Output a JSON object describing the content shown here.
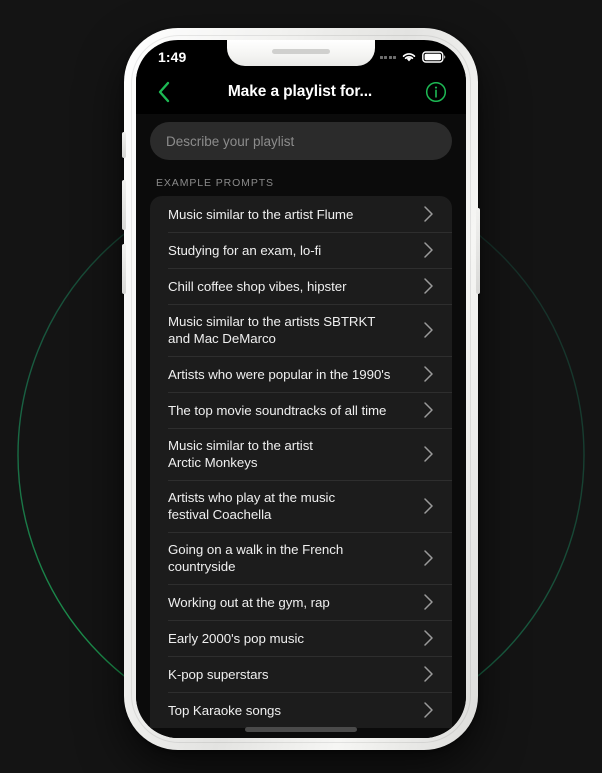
{
  "status_bar": {
    "time": "1:49",
    "cellular_icon": "cellular-dots-icon",
    "wifi_icon": "wifi-icon",
    "battery_icon": "battery-icon"
  },
  "nav": {
    "back_icon": "chevron-left-icon",
    "title": "Make a playlist for...",
    "info_icon": "info-circle-icon"
  },
  "search": {
    "placeholder": "Describe your playlist",
    "value": ""
  },
  "section": {
    "label": "EXAMPLE PROMPTS"
  },
  "prompts": [
    {
      "text": "Music similar to the artist Flume",
      "lines": 1
    },
    {
      "text": "Studying for an exam, lo-fi",
      "lines": 1
    },
    {
      "text": "Chill coffee shop vibes, hipster",
      "lines": 1
    },
    {
      "text": "Music similar to the artists SBTRKT\nand Mac DeMarco",
      "lines": 2
    },
    {
      "text": "Artists who were popular in the 1990's",
      "lines": 1
    },
    {
      "text": "The top movie soundtracks of all time",
      "lines": 1
    },
    {
      "text": "Music similar to the artist\nArctic Monkeys",
      "lines": 2
    },
    {
      "text": "Artists who play at the music\nfestival Coachella",
      "lines": 2
    },
    {
      "text": "Going on a walk in the French\ncountryside",
      "lines": 2
    },
    {
      "text": "Working out at the gym, rap",
      "lines": 1
    },
    {
      "text": "Early 2000's pop music",
      "lines": 1
    },
    {
      "text": "K-pop superstars",
      "lines": 1
    },
    {
      "text": "Top Karaoke songs",
      "lines": 1
    }
  ],
  "chevron_icon": "chevron-right-icon",
  "home_indicator": "home-indicator-bar",
  "colors": {
    "accent_green": "#1db954",
    "page_background": "#141414",
    "screen_background": "#0b0b0b",
    "card_background": "#1c1c1c",
    "divider": "#2e2e2e",
    "input_background": "#2b2b2b",
    "secondary_text": "#8a8a8a",
    "primary_text": "#efefef",
    "arc_stroke": "#1f6e52"
  }
}
